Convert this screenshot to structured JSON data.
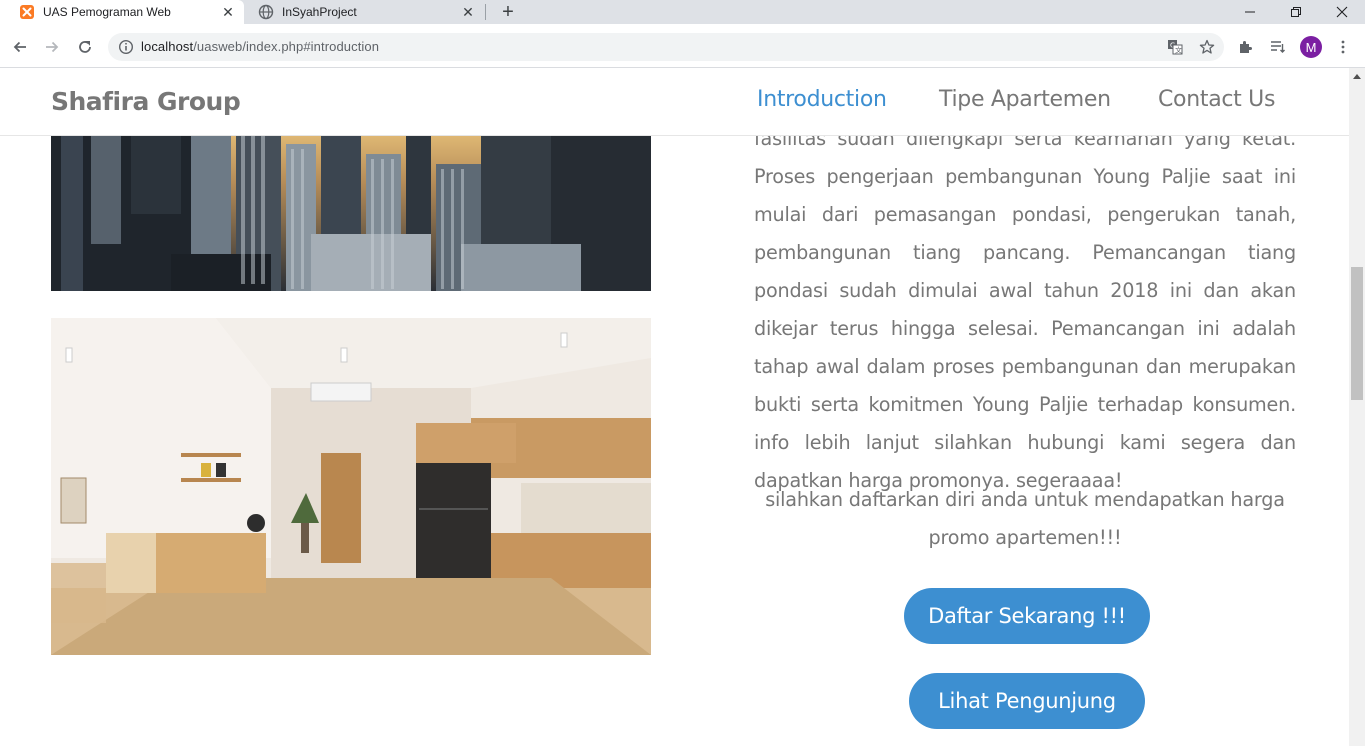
{
  "browser": {
    "tabs": [
      {
        "title": "UAS Pemograman Web",
        "active": true,
        "favicon": "xampp-icon"
      },
      {
        "title": "InSyahProject",
        "active": false,
        "favicon": "globe-icon"
      }
    ],
    "url_host": "localhost",
    "url_path": "/uasweb/index.php#introduction",
    "profile_initial": "M"
  },
  "site": {
    "brand": "Shafira Group",
    "nav": [
      {
        "label": "Introduction",
        "active": true
      },
      {
        "label": "Tipe Apartemen",
        "active": false
      },
      {
        "label": "Contact Us",
        "active": false
      }
    ]
  },
  "article": {
    "text": "fasilitas sudah dilengkapi serta keamanan yang ketat. Proses pengerjaan pembangunan Young Paljie saat ini mulai dari pemasangan pondasi, pengerukan tanah, pembangunan tiang pancang. Pemancangan tiang pondasi sudah dimulai awal tahun 2018 ini dan akan dikejar terus hingga selesai. Pemancangan ini adalah tahap awal dalam proses pembangunan dan merupakan bukti serta komitmen Young Paljie terhadap konsumen. info lebih lanjut silahkan hubungi kami segera dan dapatkan harga promonya. segeraaaa!",
    "promo": "silahkan daftarkan diri anda untuk mendapatkan harga promo apartemen!!!"
  },
  "buttons": {
    "daftar": "Daftar Sekarang !!!",
    "lihat": "Lihat Pengunjung"
  },
  "colors": {
    "accent": "#3d8fd1",
    "text_muted": "#777777"
  }
}
